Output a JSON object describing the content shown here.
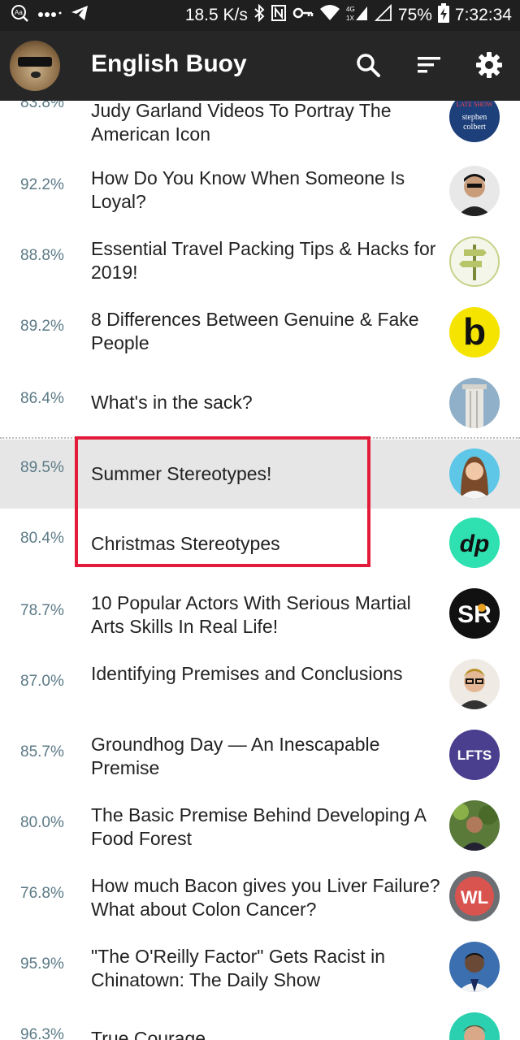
{
  "status_bar": {
    "speed": "18.5 K/s",
    "battery": "75%",
    "time": "7:32:34"
  },
  "app": {
    "title": "English Buoy",
    "icons": [
      "search-icon",
      "sort-icon",
      "settings-icon"
    ]
  },
  "items": [
    {
      "score": "83.8%",
      "title": "Judy Garland Videos To Portray The American Icon",
      "thumb": "stephen-colbert-show",
      "thumb_color": "#1d3f7a"
    },
    {
      "score": "92.2%",
      "title": "How Do You Know When Someone Is Loyal?",
      "thumb": "man-portrait",
      "thumb_color": "#6b5a4e"
    },
    {
      "score": "88.8%",
      "title": "Essential Travel Packing Tips & Hacks for 2019!",
      "thumb": "signpost-logo",
      "thumb_color": "#f3f6e8"
    },
    {
      "score": "89.2%",
      "title": "8 Differences Between Genuine & Fake People",
      "thumb": "b-logo",
      "thumb_color": "#f5e400"
    },
    {
      "score": "86.4%",
      "title": "What's in the sack?",
      "thumb": "column-photo",
      "thumb_color": "#8fb0c8"
    },
    {
      "score": "89.5%",
      "title": "Summer Stereotypes!",
      "thumb": "woman-portrait",
      "thumb_color": "#5ec7e8"
    },
    {
      "score": "80.4%",
      "title": "Christmas Stereotypes",
      "thumb": "dp-logo",
      "thumb_color": "#2fe0b0"
    },
    {
      "score": "78.7%",
      "title": "10 Popular Actors With Serious Martial Arts Skills In Real Life!",
      "thumb": "sr-logo",
      "thumb_color": "#111111"
    },
    {
      "score": "87.0%",
      "title": "Identifying Premises and Conclusions",
      "thumb": "man-glasses-portrait",
      "thumb_color": "#d8c9b8"
    },
    {
      "score": "85.7%",
      "title": "Groundhog Day — An Inescapable Premise",
      "thumb": "lfts-logo",
      "thumb_color": "#4a3f8f"
    },
    {
      "score": "80.0%",
      "title": "The Basic Premise Behind Developing A Food Forest",
      "thumb": "man-plants-portrait",
      "thumb_color": "#5a7a3a"
    },
    {
      "score": "76.8%",
      "title": "How much Bacon gives you Liver Failure? What about Colon Cancer?",
      "thumb": "wl-logo",
      "thumb_color": "#6b6f73"
    },
    {
      "score": "95.9%",
      "title": "\"The O'Reilly Factor\" Gets Racist in Chinatown: The Daily Show",
      "thumb": "man-portrait-2",
      "thumb_color": "#3b6fb0"
    },
    {
      "score": "96.3%",
      "title": "True Courage",
      "thumb": "man-portrait-3",
      "thumb_color": "#2ad0b0"
    }
  ],
  "highlight_index": 5,
  "thumb_text": {
    "b": "b",
    "dp": "dp",
    "sr": "SR",
    "lfts": "LFTS",
    "wl": "WL",
    "colbert_top": "LATE SHOW",
    "colbert_name": "stephen colbert"
  },
  "colors": {
    "status_bg": "#1f1f1f",
    "appbar_bg": "#262626",
    "score": "#5b7a86",
    "highlight": "#e6e6e6",
    "red_box": "#e31b3a"
  }
}
